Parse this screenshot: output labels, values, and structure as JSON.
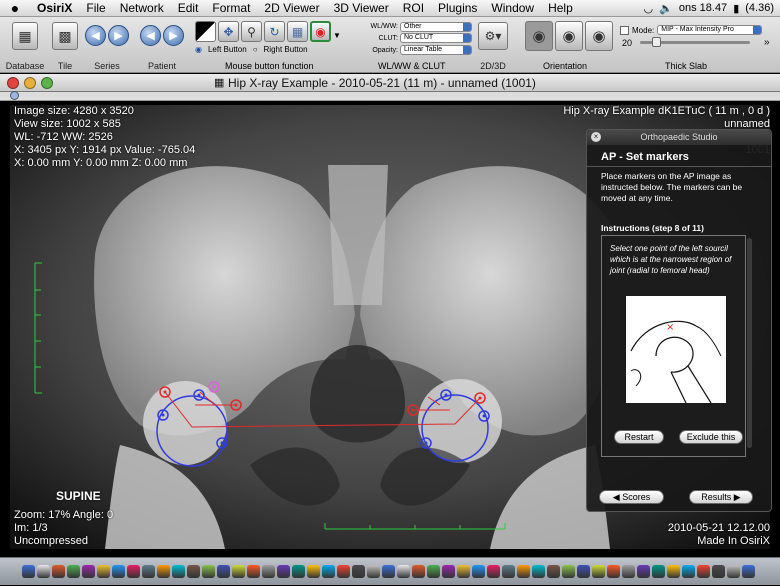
{
  "menubar": {
    "apple": "",
    "app": "OsiriX",
    "items": [
      "File",
      "Network",
      "Edit",
      "Format",
      "2D Viewer",
      "3D Viewer",
      "ROI",
      "Plugins",
      "Window",
      "Help"
    ],
    "clock": "ons 18.47",
    "battery": "(4.36)"
  },
  "toolbar": {
    "database": "Database",
    "tile": "Tile",
    "series": "Series",
    "patient": "Patient",
    "mouse_fn": "Mouse button function",
    "left_button": "Left Button",
    "right_button": "Right Button",
    "wlww_label": "WL/WW:",
    "wlww_value": "Other",
    "clut_label": "CLUT:",
    "clut_value": "No CLUT",
    "opacity_label": "Opacity:",
    "opacity_value": "Linear Table",
    "wlww_group": "WL/WW & CLUT",
    "d2d3": "2D/3D",
    "orientation": "Orientation",
    "mode_label": "Mode:",
    "mode_value": "MIP - Max Intensity Pro",
    "slab_value": "20",
    "thick_slab": "Thick Slab"
  },
  "window": {
    "title": "Hip X-ray Example - 2010-05-21 (11 m) - unnamed (1001)"
  },
  "overlay": {
    "tl": [
      "Image size: 4280 x 3520",
      "View size: 1002 x 585",
      "WL: -712 WW: 2526",
      "X: 3405 px Y: 1914 px Value: -765.04",
      "X: 0.00 mm Y: 0.00 mm Z: 0.00 mm"
    ],
    "tr": [
      "Hip X-ray Example dK1ETuC ( 11 m , 0 d )",
      "unnamed",
      "1001"
    ],
    "bl": [
      "Zoom: 17% Angle: 0",
      "Im: 1/3",
      "Uncompressed"
    ],
    "br": [
      "2010-05-21 12.12.00",
      "Made In OsiriX"
    ],
    "orientation_label": "SUPINE"
  },
  "panel": {
    "title": "Orthopaedic Studio",
    "heading": "AP - Set markers",
    "desc": "Place markers on the AP image as instructed below. The markers can be moved at any time.",
    "step": "Instructions (step 8 of 11)",
    "instruction": "Select one point of the left sourcil which is at the narrowest region of joint (radial to femoral head)",
    "restart": "Restart",
    "exclude": "Exclude this",
    "scores": "◀ Scores",
    "results": "Results ▶"
  },
  "colors": {
    "marker_red": "#e02a2a",
    "marker_blue": "#2f3de0",
    "marker_magenta": "#e060e0",
    "ruler_green": "#2ecc40"
  }
}
